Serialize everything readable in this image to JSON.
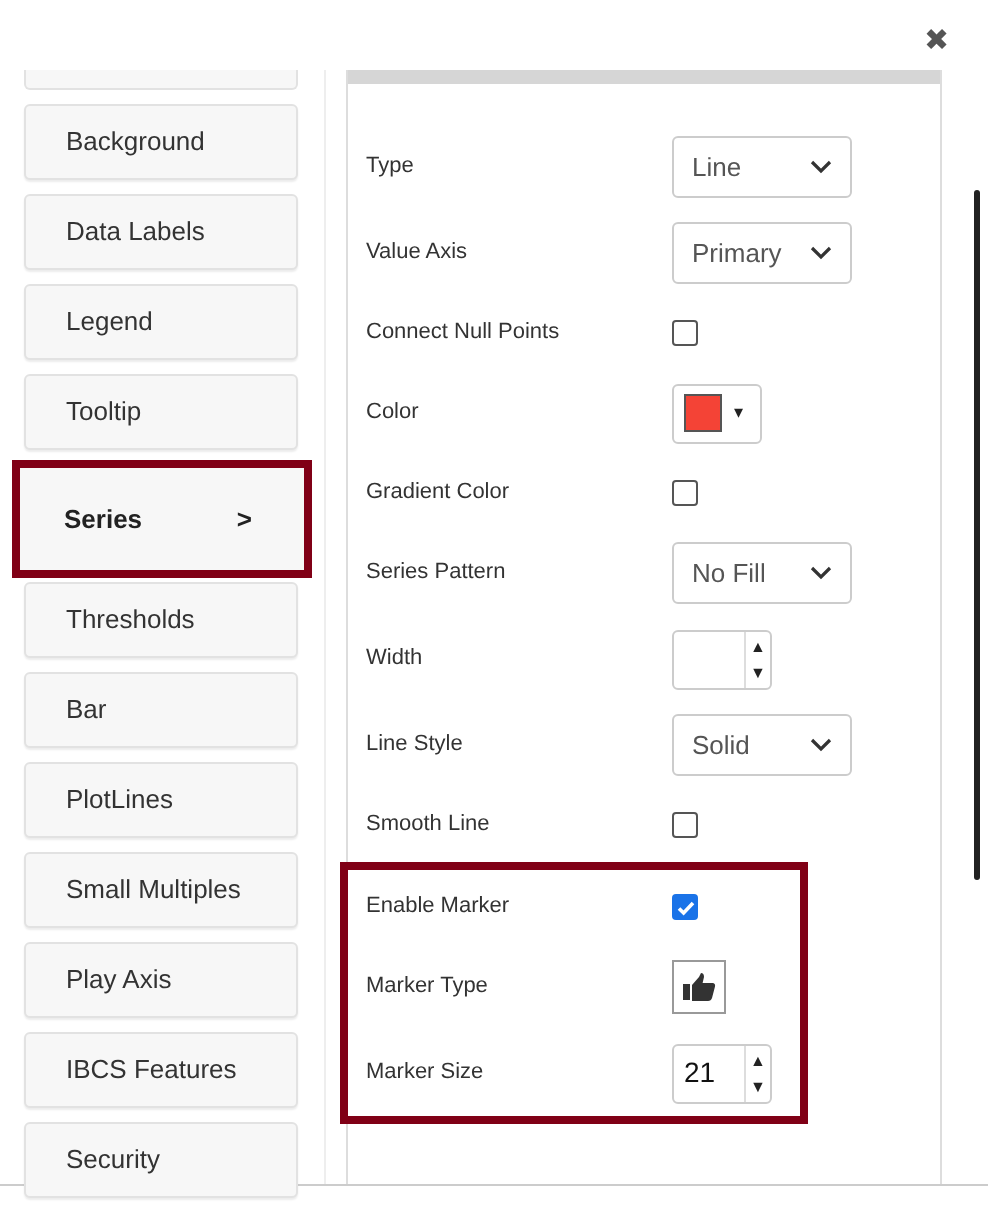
{
  "close": {
    "label": "✖"
  },
  "sidebar": {
    "items": [
      {
        "label": "Background",
        "selected": false
      },
      {
        "label": "Data Labels",
        "selected": false
      },
      {
        "label": "Legend",
        "selected": false
      },
      {
        "label": "Tooltip",
        "selected": false
      },
      {
        "label": "Series",
        "selected": true,
        "arrow": ">"
      },
      {
        "label": "Thresholds",
        "selected": false
      },
      {
        "label": "Bar",
        "selected": false
      },
      {
        "label": "PlotLines",
        "selected": false
      },
      {
        "label": "Small Multiples",
        "selected": false
      },
      {
        "label": "Play Axis",
        "selected": false
      },
      {
        "label": "IBCS Features",
        "selected": false
      },
      {
        "label": "Security",
        "selected": false
      }
    ]
  },
  "fields": [
    {
      "label": "Type",
      "kind": "select",
      "value": "Line"
    },
    {
      "label": "Value Axis",
      "kind": "select",
      "value": "Primary"
    },
    {
      "label": "Connect Null Points",
      "kind": "checkbox",
      "checked": false
    },
    {
      "label": "Color",
      "kind": "color",
      "color": "#f44336",
      "caret": "▾"
    },
    {
      "label": "Gradient Color",
      "kind": "checkbox",
      "checked": false
    },
    {
      "label": "Series Pattern",
      "kind": "select",
      "value": "No Fill"
    },
    {
      "label": "Width",
      "kind": "spinner",
      "up": "▲",
      "down": "▼"
    },
    {
      "label": "Line Style",
      "kind": "select",
      "value": "Solid"
    },
    {
      "label": "Smooth Line",
      "kind": "checkbox",
      "checked": false
    }
  ],
  "marker_group": {
    "highlighted": true,
    "fields": [
      {
        "label": "Enable Marker",
        "kind": "checkbox",
        "checked": true
      },
      {
        "label": "Marker Type",
        "kind": "icon"
      },
      {
        "label": "Marker Size",
        "kind": "spinner",
        "value": "21",
        "up": "▲",
        "down": "▼"
      }
    ]
  }
}
